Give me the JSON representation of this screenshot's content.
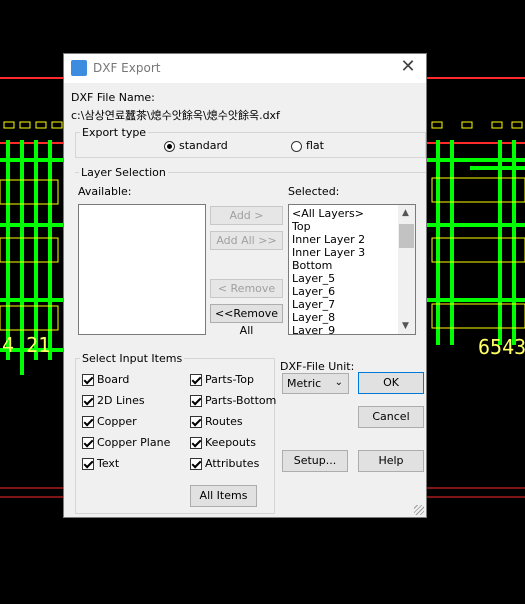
{
  "window": {
    "title": "DXF Export",
    "close_icon": "close-icon"
  },
  "file": {
    "label": "DXF File Name:",
    "path": "c:\\삼상연료蠶茶\\熄수앗餘옥\\熄수앗餘옥.dxf"
  },
  "export_type": {
    "label": "Export type",
    "options": [
      {
        "label": "standard",
        "selected": true
      },
      {
        "label": "flat",
        "selected": false
      }
    ]
  },
  "layer_selection": {
    "label": "Layer Selection",
    "available_label": "Available:",
    "selected_label": "Selected:",
    "available": [],
    "selected": [
      "<All Layers>",
      "Top",
      "Inner Layer 2",
      "Inner Layer 3",
      "Bottom",
      "Layer_5",
      "Layer_6",
      "Layer_7",
      "Layer_8",
      "Layer_9"
    ],
    "buttons": {
      "add": "Add >",
      "add_all": "Add All >>",
      "remove": "< Remove",
      "remove_all": "<<Remove All"
    }
  },
  "input_items": {
    "label": "Select Input Items",
    "left": [
      {
        "label": "Board",
        "checked": true
      },
      {
        "label": "2D Lines",
        "checked": true
      },
      {
        "label": "Copper",
        "checked": true
      },
      {
        "label": "Copper Plane",
        "checked": true
      },
      {
        "label": "Text",
        "checked": true
      }
    ],
    "right": [
      {
        "label": "Parts-Top",
        "checked": true
      },
      {
        "label": "Parts-Bottom",
        "checked": true
      },
      {
        "label": "Routes",
        "checked": true
      },
      {
        "label": "Keepouts",
        "checked": true
      },
      {
        "label": "Attributes",
        "checked": true
      }
    ],
    "all_items_button": "All  Items"
  },
  "unit": {
    "label": "DXF-File Unit:",
    "value": "Metric"
  },
  "actions": {
    "ok": "OK",
    "cancel": "Cancel",
    "setup": "Setup...",
    "help": "Help"
  },
  "background": {
    "left_text": "4 21",
    "right_text": "6543",
    "trace_color": "#00ff00",
    "outline_color": "#ff2a2a",
    "pad_color": "#ffff00"
  }
}
